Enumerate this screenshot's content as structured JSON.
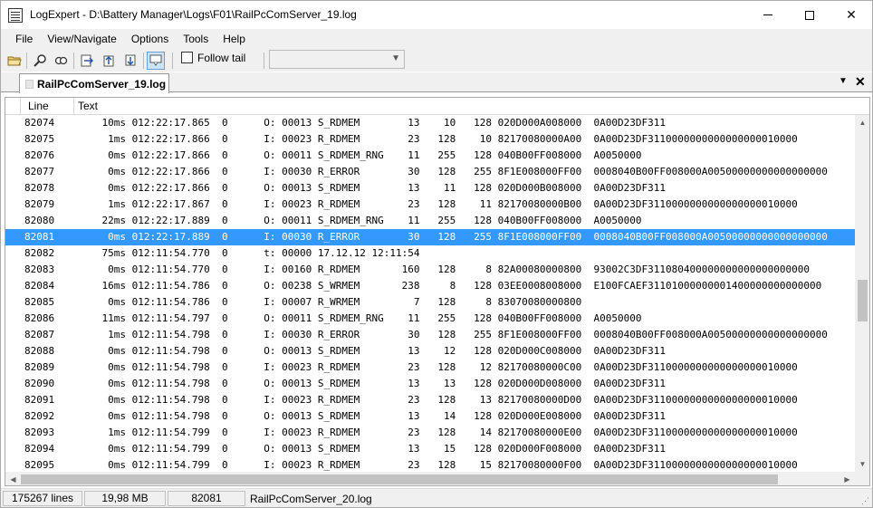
{
  "window": {
    "title": "LogExpert - D:\\Battery Manager\\Logs\\F01\\RailPcComServer_19.log",
    "app_icon": "log-document-icon"
  },
  "menu": [
    "File",
    "View/Navigate",
    "Options",
    "Tools",
    "Help"
  ],
  "toolbar": {
    "icons": [
      "open-folder-icon",
      "search-icon",
      "filter-search-icon",
      "go-to-line-icon",
      "bookmark-up-icon",
      "bookmark-down-icon",
      "bubble-view-icon"
    ],
    "follow_tail_label": "Follow tail",
    "follow_tail_checked": false,
    "combo_value": ""
  },
  "tab": {
    "label": "RailPcComServer_19.log"
  },
  "grid": {
    "columns": [
      "Line",
      "Text"
    ],
    "selected_line": "82081",
    "rows": [
      {
        "line": "82074",
        "text": "    10ms 012:22:17.865  0      O: 00013 S_RDMEM        13    10   128 020D000A008000  0A00D23DF311"
      },
      {
        "line": "82075",
        "text": "     1ms 012:22:17.866  0      I: 00023 R_RDMEM        23   128    10 82170080000A00  0A00D23DF3110000000000000000010000"
      },
      {
        "line": "82076",
        "text": "     0ms 012:22:17.866  0      O: 00011 S_RDMEM_RNG    11   255   128 040B00FF008000  A0050000"
      },
      {
        "line": "82077",
        "text": "     0ms 012:22:17.866  0      I: 00030 R_ERROR        30   128   255 8F1E008000FF00  0008040B00FF008000A00500000000000000000"
      },
      {
        "line": "82078",
        "text": "     0ms 012:22:17.866  0      O: 00013 S_RDMEM        13    11   128 020D000B008000  0A00D23DF311"
      },
      {
        "line": "82079",
        "text": "     1ms 012:22:17.867  0      I: 00023 R_RDMEM        23   128    11 82170080000B00  0A00D23DF3110000000000000000010000"
      },
      {
        "line": "82080",
        "text": "    22ms 012:22:17.889  0      O: 00011 S_RDMEM_RNG    11   255   128 040B00FF008000  A0050000"
      },
      {
        "line": "82081",
        "text": "     0ms 012:22:17.889  0      I: 00030 R_ERROR        30   128   255 8F1E008000FF00  0008040B00FF008000A00500000000000000000"
      },
      {
        "line": "82082",
        "text": "    75ms 012:11:54.770  0      t: 00000 17.12.12 12:11:54"
      },
      {
        "line": "82083",
        "text": "     0ms 012:11:54.770  0      I: 00160 R_RDMEM       160   128     8 82A00080000800  93002C3DF311080400000000000000000000"
      },
      {
        "line": "82084",
        "text": "    16ms 012:11:54.786  0      O: 00238 S_WRMEM       238     8   128 03EE0008008000  E100FCAEF31101000000001400000000000000"
      },
      {
        "line": "82085",
        "text": "     0ms 012:11:54.786  0      I: 00007 R_WRMEM         7   128     8 83070080000800"
      },
      {
        "line": "82086",
        "text": "    11ms 012:11:54.797  0      O: 00011 S_RDMEM_RNG    11   255   128 040B00FF008000  A0050000"
      },
      {
        "line": "82087",
        "text": "     1ms 012:11:54.798  0      I: 00030 R_ERROR        30   128   255 8F1E008000FF00  0008040B00FF008000A00500000000000000000"
      },
      {
        "line": "82088",
        "text": "     0ms 012:11:54.798  0      O: 00013 S_RDMEM        13    12   128 020D000C008000  0A00D23DF311"
      },
      {
        "line": "82089",
        "text": "     0ms 012:11:54.798  0      I: 00023 R_RDMEM        23   128    12 82170080000C00  0A00D23DF3110000000000000000010000"
      },
      {
        "line": "82090",
        "text": "     0ms 012:11:54.798  0      O: 00013 S_RDMEM        13    13   128 020D000D008000  0A00D23DF311"
      },
      {
        "line": "82091",
        "text": "     0ms 012:11:54.798  0      I: 00023 R_RDMEM        23   128    13 82170080000D00  0A00D23DF3110000000000000000010000"
      },
      {
        "line": "82092",
        "text": "     0ms 012:11:54.798  0      O: 00013 S_RDMEM        13    14   128 020D000E008000  0A00D23DF311"
      },
      {
        "line": "82093",
        "text": "     1ms 012:11:54.799  0      I: 00023 R_RDMEM        23   128    14 82170080000E00  0A00D23DF3110000000000000000010000"
      },
      {
        "line": "82094",
        "text": "     0ms 012:11:54.799  0      O: 00013 S_RDMEM        13    15   128 020D000F008000  0A00D23DF311"
      },
      {
        "line": "82095",
        "text": "     0ms 012:11:54.799  0      I: 00023 R_RDMEM        23   128    15 82170080000F00  0A00D23DF3110000000000000000010000"
      }
    ]
  },
  "status": {
    "lines": "175267 lines",
    "size": "19,98 MB",
    "position": "82081",
    "file": "RailPcComServer_20.log"
  },
  "colors": {
    "selection": "#3399ff",
    "toolbar_icon": "#2a5aa8"
  }
}
